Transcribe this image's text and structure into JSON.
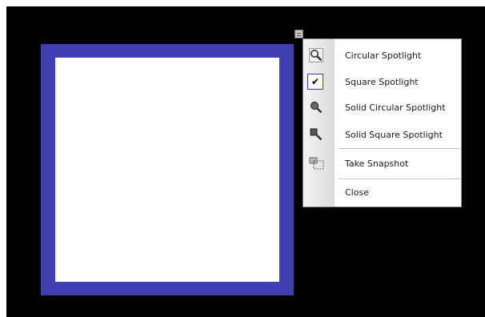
{
  "menu": {
    "items": [
      {
        "label": "Circular Spotlight",
        "icon": "magnifier-circle-icon",
        "checked": false
      },
      {
        "label": "Square Spotlight",
        "icon": "checkmark-icon",
        "checked": true
      },
      {
        "label": "Solid Circular Spotlight",
        "icon": "magnifier-solid-circle-icon",
        "checked": false
      },
      {
        "label": "Solid Square Spotlight",
        "icon": "magnifier-solid-square-icon",
        "checked": false
      },
      {
        "label": "Take Snapshot",
        "icon": "snapshot-icon",
        "checked": false
      },
      {
        "label": "Close",
        "icon": "",
        "checked": false
      }
    ]
  },
  "colors": {
    "background": "#000000",
    "spotlight_frame": "#3e3eb0",
    "spotlight_area": "#ffffff"
  }
}
